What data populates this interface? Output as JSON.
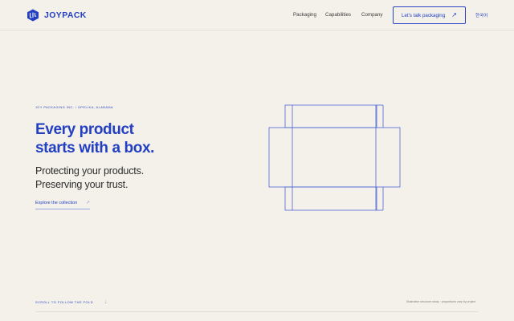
{
  "brand": {
    "name": "JOYPACK",
    "logo_icon": "cube-logo-icon",
    "accent": "#2440c2"
  },
  "nav": {
    "packaging": "Packaging",
    "capabilities": "Capabilities",
    "company": "Company"
  },
  "cta": {
    "label": "Let's talk packaging",
    "arrow": "↗",
    "icon": "arrow-up-right-icon"
  },
  "lang": {
    "label": "한국어"
  },
  "hero": {
    "eyebrow": "JOY PACKAGING INC. / OPELIKA, ALABAMA",
    "headline_line1": "Every product",
    "headline_line2": "starts with a box.",
    "sub_line1": "Protecting your products.",
    "sub_line2": "Preserving your trust.",
    "explore_label": "Explore the collection",
    "explore_arrow": "↗",
    "illustration_icon": "box-dieline-icon"
  },
  "footer": {
    "scroll_label": "SCROLL TO FOLLOW THE FOLD",
    "scroll_arrow": "↓",
    "caption": "Illustrative structure study · proportions vary by project"
  },
  "colors": {
    "background": "#f4f1ea",
    "text": "#2b2b2b",
    "line": "#2440c2"
  }
}
